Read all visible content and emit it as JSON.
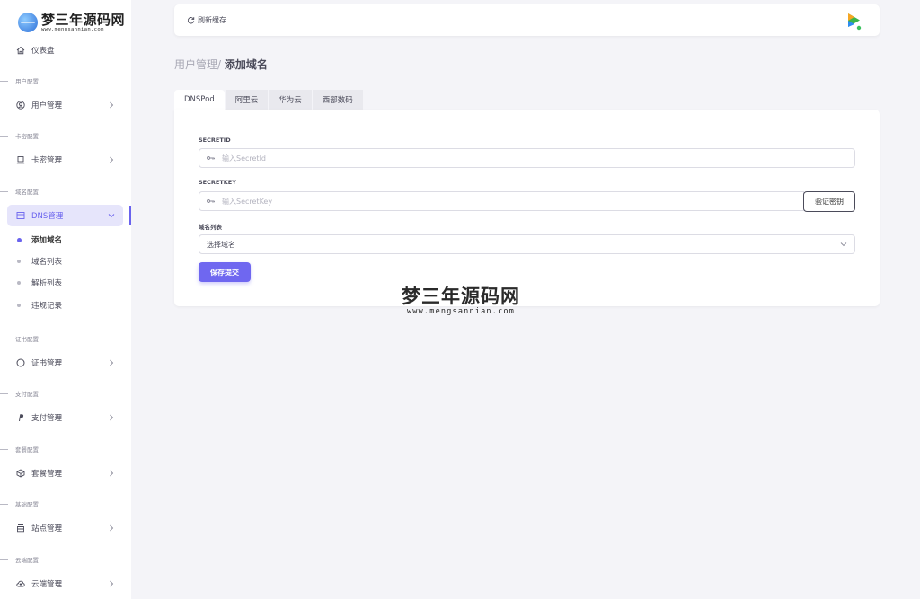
{
  "logo": {
    "main": "梦三年源码网",
    "sub": "www.mengsannian.com"
  },
  "sidebar": {
    "dashboard": "仪表盘",
    "sections": {
      "user": "用户配置",
      "card": "卡密配置",
      "domain": "域名配置",
      "cert": "证书配置",
      "pay": "支付配置",
      "plan": "套餐配置",
      "basic": "基础配置",
      "cloud": "云端配置"
    },
    "items": {
      "user": "用户管理",
      "card": "卡密管理",
      "dns": "DNS管理",
      "cert": "证书管理",
      "pay": "支付管理",
      "plan": "套餐管理",
      "site": "站点管理",
      "cloud": "云端管理"
    },
    "dns_sub": [
      "添加域名",
      "域名列表",
      "解析列表",
      "违规记录"
    ]
  },
  "topbar": {
    "refresh_label": "刷新缓存"
  },
  "breadcrumb": {
    "parent": "用户管理/",
    "current": "添加域名"
  },
  "tabs": [
    "DNSPod",
    "阿里云",
    "华为云",
    "西部数码"
  ],
  "form": {
    "secretid_label": "SECRETID",
    "secretid_placeholder": "输入SecretId",
    "secretkey_label": "SECRETKEY",
    "secretkey_placeholder": "输入SecretKey",
    "verify_label": "验证密钥",
    "domain_list_label": "域名列表",
    "domain_select_value": "选择域名",
    "submit_label": "保存提交"
  },
  "watermark": {
    "main": "梦三年源码网",
    "sub": "www.mengsannian.com"
  },
  "colors": {
    "accent": "#6f67f0",
    "active_bg": "#e6e5fb",
    "background": "#f4f4f8"
  }
}
